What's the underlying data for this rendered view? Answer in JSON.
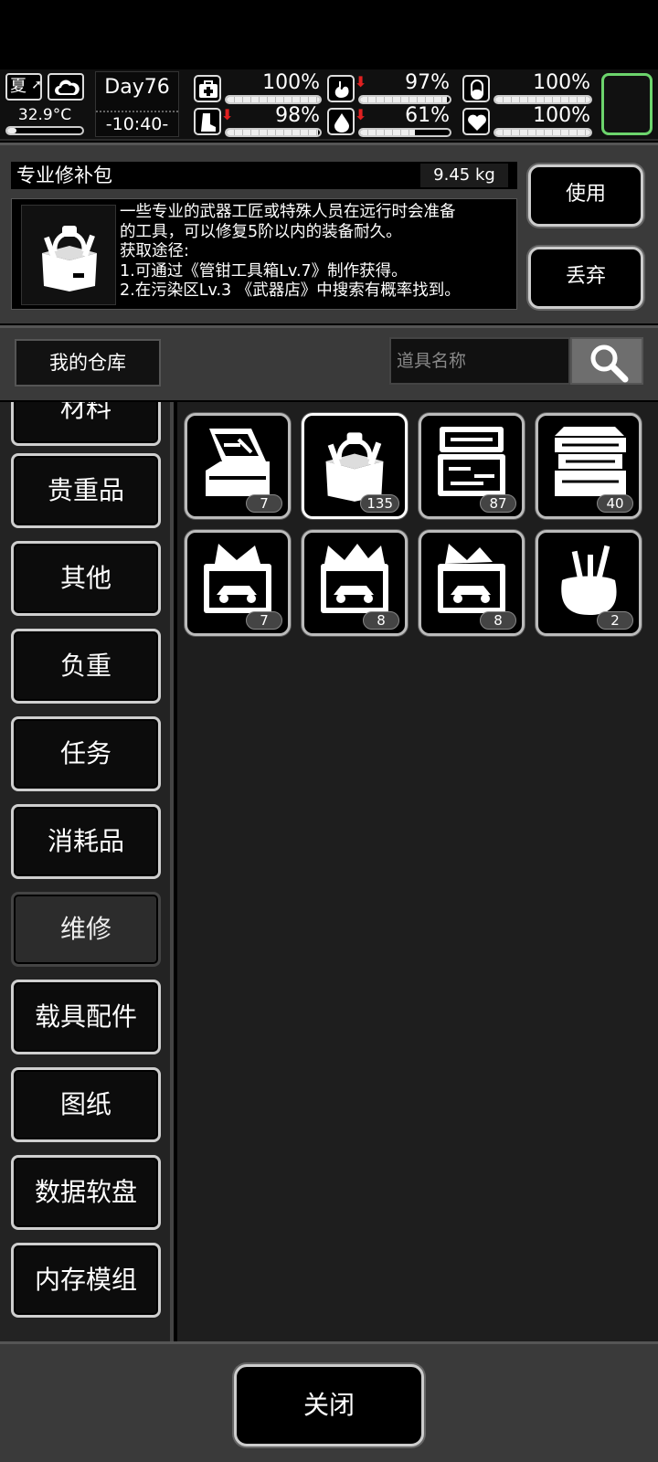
{
  "hud": {
    "season": "夏",
    "temperature": "32.9°C",
    "day": "Day76",
    "time": "-10:40-",
    "stats": [
      {
        "id": "health",
        "icon": "first-aid-icon",
        "value": "100%",
        "level": 100,
        "down": false
      },
      {
        "id": "hunger",
        "icon": "stomach-icon",
        "value": "97%",
        "level": 97,
        "down": true
      },
      {
        "id": "immunity",
        "icon": "pill-icon",
        "value": "100%",
        "level": 100,
        "down": false
      },
      {
        "id": "stamina",
        "icon": "boot-icon",
        "value": "98%",
        "level": 98,
        "down": true
      },
      {
        "id": "thirst",
        "icon": "water-drop-icon",
        "value": "61%",
        "level": 61,
        "down": true
      },
      {
        "id": "mood",
        "icon": "heart-icon",
        "value": "100%",
        "level": 100,
        "down": false
      }
    ],
    "accent_color": "#6cd46c"
  },
  "details": {
    "name": "专业修补包",
    "weight": "9.45 kg",
    "description_lines": [
      "一些专业的武器工匠或特殊人员在远行时会准备",
      "的工具，可以修复5阶以内的装备耐久。",
      "获取途径:",
      "1.可通过《管钳工具箱Lv.7》制作获得。",
      "2.在污染区Lv.3 《武器店》中搜索有概率找到。"
    ],
    "use_label": "使用",
    "drop_label": "丢弃"
  },
  "toolbar": {
    "warehouse_label": "我的仓库",
    "search_placeholder": "道具名称"
  },
  "categories": [
    {
      "label": "材料",
      "active": false
    },
    {
      "label": "贵重品",
      "active": false
    },
    {
      "label": "其他",
      "active": false
    },
    {
      "label": "负重",
      "active": false
    },
    {
      "label": "任务",
      "active": false
    },
    {
      "label": "消耗品",
      "active": false
    },
    {
      "label": "维修",
      "active": true
    },
    {
      "label": "载具配件",
      "active": false
    },
    {
      "label": "图纸",
      "active": false
    },
    {
      "label": "数据软盘",
      "active": false
    },
    {
      "label": "内存模组",
      "active": false
    }
  ],
  "items": [
    {
      "icon": "open-toolbox-pliers-icon",
      "count": "7",
      "selected": false
    },
    {
      "icon": "repair-bag-icon",
      "count": "135",
      "selected": true
    },
    {
      "icon": "tool-case-icon",
      "count": "87",
      "selected": false
    },
    {
      "icon": "cantilever-toolbox-icon",
      "count": "40",
      "selected": false
    },
    {
      "icon": "car-toolbox-icon",
      "count": "7",
      "selected": false
    },
    {
      "icon": "car-toolbox-full-icon",
      "count": "8",
      "selected": false
    },
    {
      "icon": "car-toolbox-wrench-icon",
      "count": "8",
      "selected": false
    },
    {
      "icon": "tool-pouch-icon",
      "count": "2",
      "selected": false
    }
  ],
  "footer": {
    "close_label": "关闭"
  }
}
